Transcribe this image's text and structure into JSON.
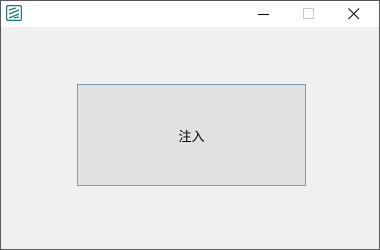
{
  "window": {
    "controls": {
      "minimize_icon": "minimize-icon",
      "maximize_icon": "maximize-icon",
      "close_icon": "close-icon"
    },
    "app_icon": "app-logo-icon",
    "accent_color": "#1a7a7a"
  },
  "main": {
    "inject_button_label": "注入"
  }
}
